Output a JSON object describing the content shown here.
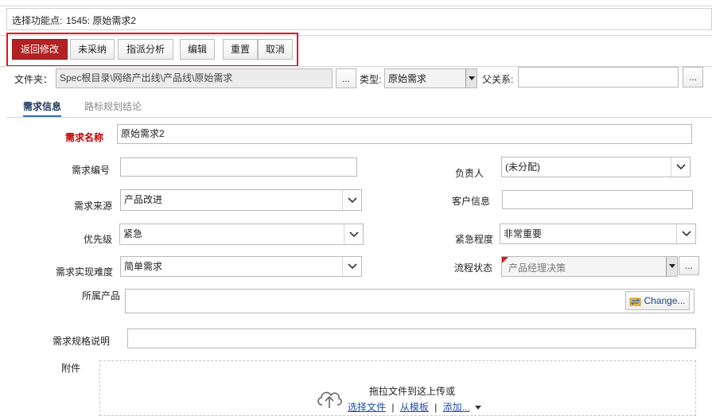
{
  "function_point": {
    "label": "选择功能点:",
    "value": "1545: 原始需求2"
  },
  "toolbar": {
    "return_edit": "返回修改",
    "not_adopted": "未采纳",
    "assign_analysis": "指派分析",
    "edit": "编辑",
    "reset": "重置",
    "cancel": "取消"
  },
  "folder": {
    "label": "文件夹：",
    "value": "Spec根目录\\网络产出线\\产品线\\原始需求",
    "browse": "..."
  },
  "type": {
    "label": "类型:",
    "value": "原始需求"
  },
  "parent": {
    "label": "父关系:",
    "value": "",
    "browse": "..."
  },
  "tabs": [
    {
      "label": "需求信息"
    },
    {
      "label": "路标规划结论"
    }
  ],
  "form": {
    "req_name": {
      "label": "需求名称",
      "value": "原始需求2"
    },
    "req_number": {
      "label": "需求编号",
      "value": ""
    },
    "owner": {
      "label": "负责人",
      "value": "(未分配)"
    },
    "req_source": {
      "label": "需求来源",
      "value": "产品改进"
    },
    "customer_info": {
      "label": "客户信息",
      "value": ""
    },
    "priority": {
      "label": "优先级",
      "value": "紧急"
    },
    "urgency": {
      "label": "紧急程度",
      "value": "非常重要"
    },
    "difficulty": {
      "label": "需求实现难度",
      "value": "简单需求"
    },
    "flow_status": {
      "label": "流程状态",
      "value": "产品经理决策",
      "browse": "..."
    },
    "product": {
      "label": "所属产品",
      "value": "",
      "change": "Change..."
    },
    "spec_desc": {
      "label": "需求规格说明",
      "value": ""
    },
    "attachment": {
      "label": "附件",
      "drop_text": "拖拉文件到这上传或",
      "choose_file": "选择文件",
      "sep1": "|",
      "from_template": "从模板",
      "sep2": "|",
      "add": "添加..."
    }
  },
  "colors": {
    "primary_button": "#b32222",
    "highlight_box": "#e0161f",
    "required_label": "#c00000",
    "tab_underline": "#2c6fb7"
  }
}
